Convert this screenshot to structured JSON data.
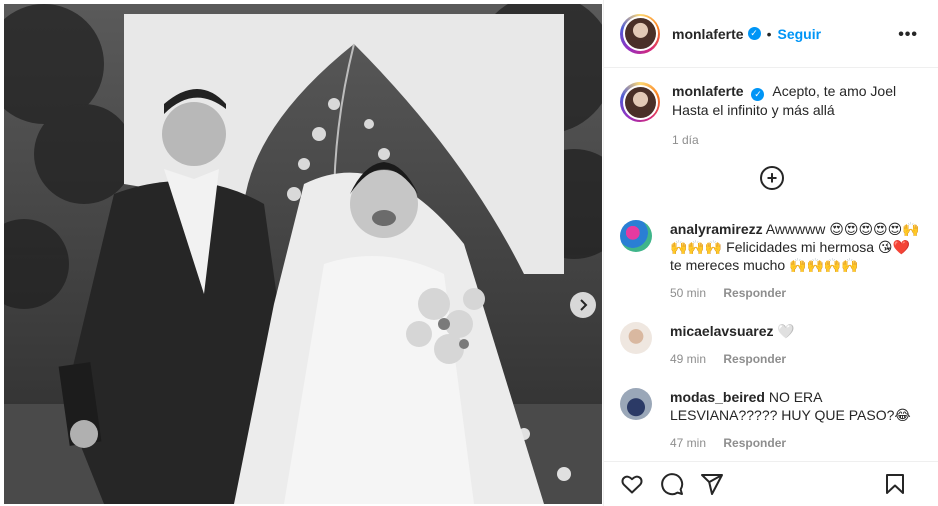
{
  "post": {
    "username": "monlaferte",
    "follow_label": "Seguir",
    "dot": "•",
    "more_label": "•••",
    "caption_line1": "Acepto, te amo Joel",
    "caption_line2": "Hasta el infinito y más allá",
    "caption_time": "1 día",
    "verified_glyph": "✓"
  },
  "comments": [
    {
      "user": "analyramirezz",
      "text": "Awwwww 😍😍😍😍😍🙌🙌🙌🙌 Felicidades mi hermosa 😘❤️ te mereces mucho 🙌🙌🙌🙌",
      "time": "50 min",
      "reply": "Responder"
    },
    {
      "user": "micaelavsuarez",
      "text": "🤍",
      "time": "49 min",
      "reply": "Responder"
    },
    {
      "user": "modas_beired",
      "text": "NO ERA LESVIANA????? HUY QUE PASO?😂",
      "time": "47 min",
      "reply": "Responder"
    }
  ],
  "icons": [
    "heart-icon",
    "comment-icon",
    "share-icon",
    "bookmark-icon",
    "add-comment-icon",
    "chevron-right-icon",
    "more-icon",
    "verified-icon"
  ]
}
